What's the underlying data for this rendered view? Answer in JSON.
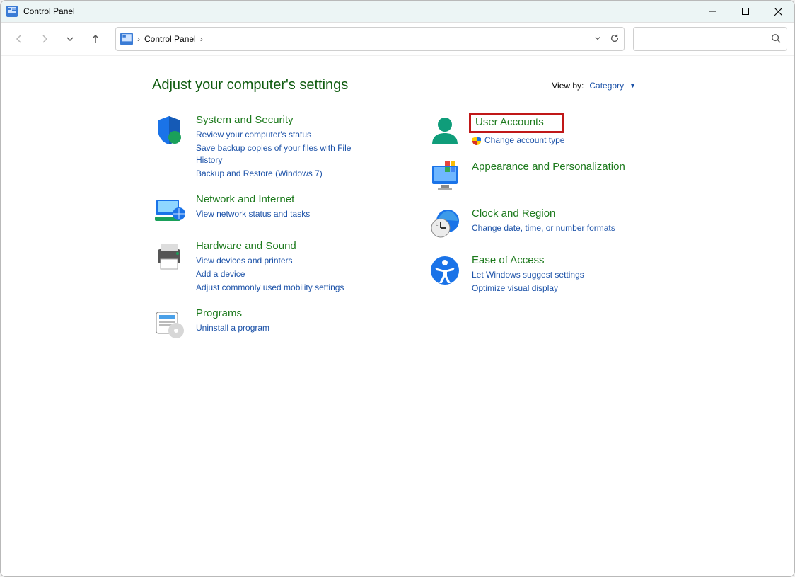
{
  "window": {
    "title": "Control Panel"
  },
  "address": {
    "crumb": "Control Panel"
  },
  "search": {
    "placeholder": ""
  },
  "heading": "Adjust your computer's settings",
  "viewby": {
    "label": "View by:",
    "value": "Category"
  },
  "categories": {
    "system_security": {
      "title": "System and Security",
      "links": [
        "Review your computer's status",
        "Save backup copies of your files with File History",
        "Backup and Restore (Windows 7)"
      ]
    },
    "network": {
      "title": "Network and Internet",
      "links": [
        "View network status and tasks"
      ]
    },
    "hardware": {
      "title": "Hardware and Sound",
      "links": [
        "View devices and printers",
        "Add a device",
        "Adjust commonly used mobility settings"
      ]
    },
    "programs": {
      "title": "Programs",
      "links": [
        "Uninstall a program"
      ]
    },
    "user_accounts": {
      "title": "User Accounts",
      "links": [
        "Change account type"
      ]
    },
    "appearance": {
      "title": "Appearance and Personalization",
      "links": []
    },
    "clock": {
      "title": "Clock and Region",
      "links": [
        "Change date, time, or number formats"
      ]
    },
    "ease": {
      "title": "Ease of Access",
      "links": [
        "Let Windows suggest settings",
        "Optimize visual display"
      ]
    }
  }
}
